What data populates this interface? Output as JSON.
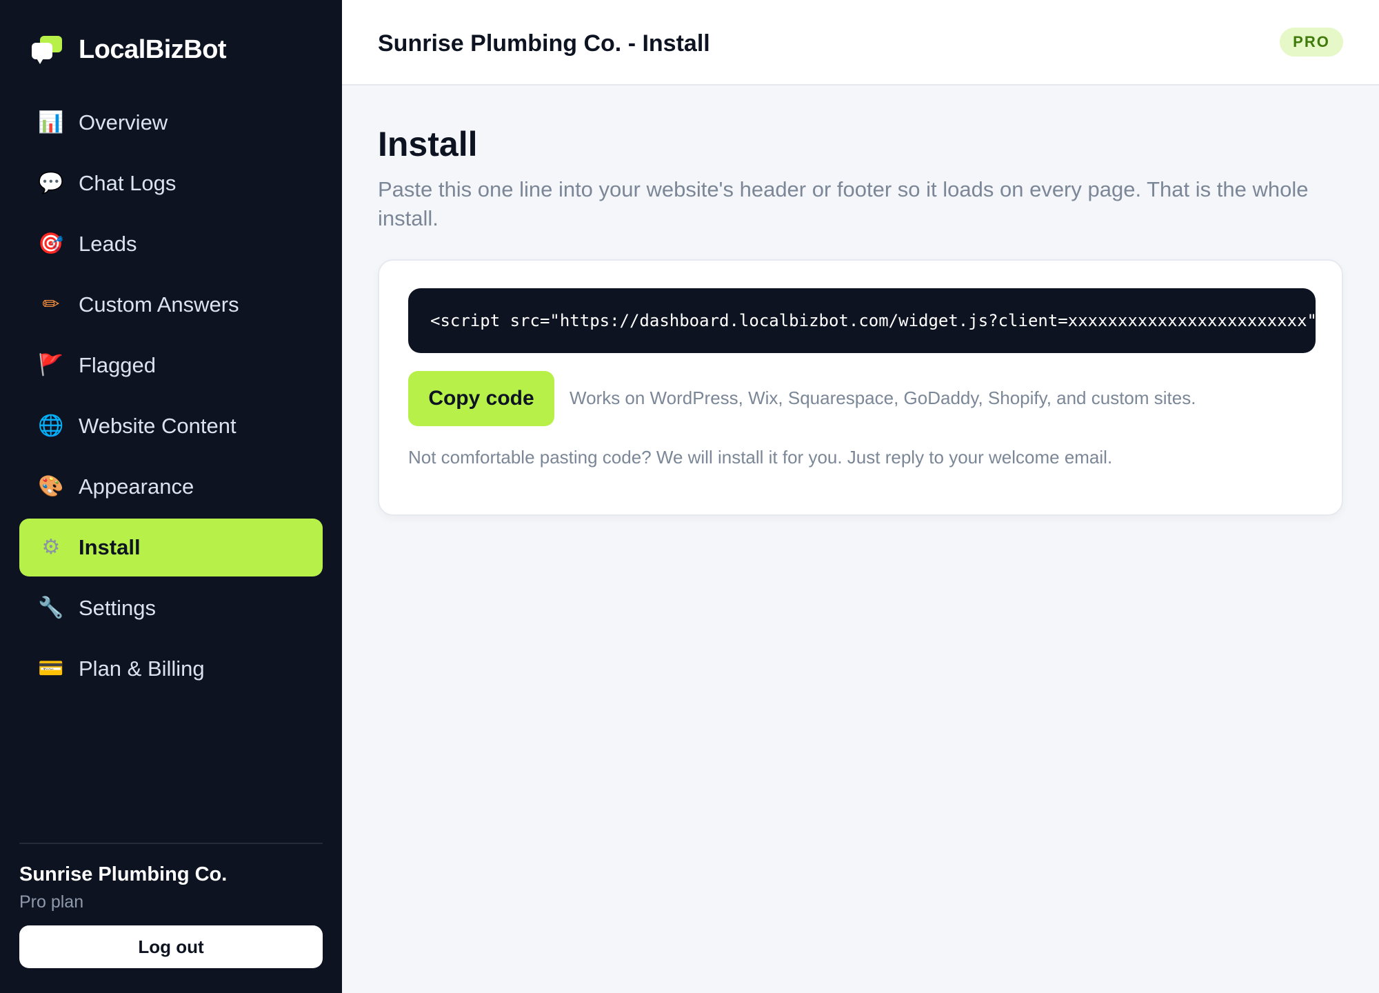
{
  "app": {
    "name": "LocalBizBot"
  },
  "sidebar": {
    "items": [
      {
        "label": "Overview",
        "icon": "bar-chart-icon",
        "glyph": "📊",
        "active": false
      },
      {
        "label": "Chat Logs",
        "icon": "speech-bubble-icon",
        "glyph": "💬",
        "active": false
      },
      {
        "label": "Leads",
        "icon": "target-icon",
        "glyph": "🎯",
        "active": false
      },
      {
        "label": "Custom Answers",
        "icon": "pencil-icon",
        "glyph": "✏",
        "active": false
      },
      {
        "label": "Flagged",
        "icon": "flag-icon",
        "glyph": "🚩",
        "active": false
      },
      {
        "label": "Website Content",
        "icon": "globe-icon",
        "glyph": "🌐",
        "active": false
      },
      {
        "label": "Appearance",
        "icon": "palette-icon",
        "glyph": "🎨",
        "active": false
      },
      {
        "label": "Install",
        "icon": "gear-icon",
        "glyph": "⚙",
        "active": true
      },
      {
        "label": "Settings",
        "icon": "wrench-icon",
        "glyph": "🔧",
        "active": false
      },
      {
        "label": "Plan & Billing",
        "icon": "credit-card-icon",
        "glyph": "💳",
        "active": false
      }
    ],
    "account": {
      "name": "Sunrise Plumbing Co.",
      "plan": "Pro plan"
    },
    "logout_label": "Log out"
  },
  "header": {
    "title": "Sunrise Plumbing Co. - Install",
    "badge": "PRO"
  },
  "main": {
    "title": "Install",
    "description": "Paste this one line into your website's header or footer so it loads on every page. That is the whole install.",
    "code": "<script src=\"https://dashboard.localbizbot.com/widget.js?client=xxxxxxxxxxxxxxxxxxxxxxxx\"",
    "copy_label": "Copy code",
    "works_on": "Works on WordPress, Wix, Squarespace, GoDaddy, Shopify, and custom sites.",
    "note": "Not comfortable pasting code? We will install it for you. Just reply to your welcome email."
  },
  "colors": {
    "sidebar_bg": "#0d1321",
    "accent": "#b8f04a",
    "badge_bg": "#e6f7c8",
    "badge_text": "#3f7a0a",
    "muted_text": "#7b8797"
  }
}
